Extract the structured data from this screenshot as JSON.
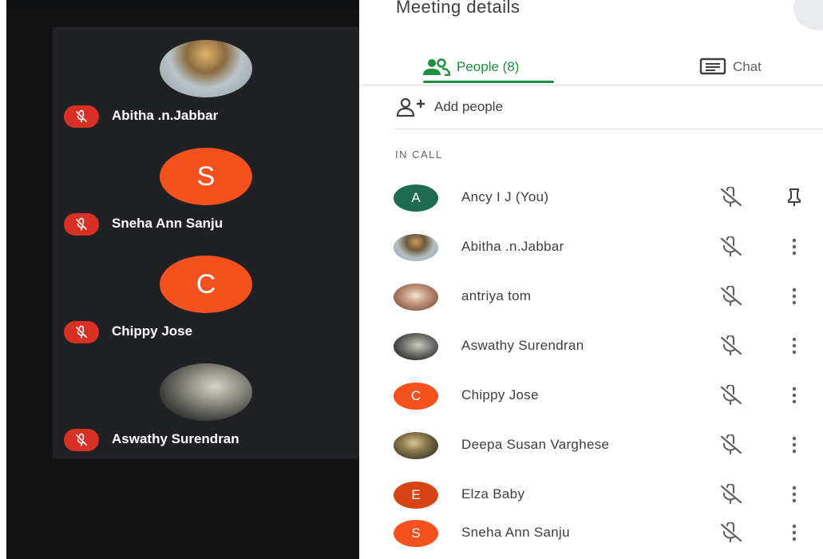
{
  "panel": {
    "title": "Meeting details",
    "tabs": [
      {
        "label": "People (8)",
        "icon": "people-icon",
        "active": true
      },
      {
        "label": "Chat",
        "icon": "chat-icon",
        "active": false
      }
    ],
    "add_people_label": "Add people",
    "section_label": "IN CALL",
    "participants": [
      {
        "name": "Ancy I J (You)",
        "avatar_letter": "A",
        "avatar_color": "#1e6b52",
        "action": "pin-icon"
      },
      {
        "name": "Abitha .n.Jabbar",
        "avatar_letter": "",
        "avatar_color": "#6f7f86",
        "action": "more-vert-icon"
      },
      {
        "name": "antriya tom",
        "avatar_letter": "",
        "avatar_color": "#b98d73",
        "action": "more-vert-icon"
      },
      {
        "name": "Aswathy Surendran",
        "avatar_letter": "",
        "avatar_color": "#5a5e5a",
        "action": "more-vert-icon"
      },
      {
        "name": "Chippy Jose",
        "avatar_letter": "C",
        "avatar_color": "#f4511e",
        "action": "more-vert-icon"
      },
      {
        "name": "Deepa Susan Varghese",
        "avatar_letter": "",
        "avatar_color": "#6b6a45",
        "action": "more-vert-icon"
      },
      {
        "name": "Elza Baby",
        "avatar_letter": "E",
        "avatar_color": "#d84315",
        "action": "more-vert-icon"
      },
      {
        "name": "Sneha Ann Sanju",
        "avatar_letter": "S",
        "avatar_color": "#f4511e",
        "action": "more-vert-icon"
      }
    ]
  },
  "video_tiles": [
    {
      "name": "Abitha .n.Jabbar",
      "avatar_letter": "",
      "avatar_color": "#7b8a8f"
    },
    {
      "name": "Sneha Ann Sanju",
      "avatar_letter": "S",
      "avatar_color": "#f4511e"
    },
    {
      "name": "Chippy Jose",
      "avatar_letter": "C",
      "avatar_color": "#f4511e"
    },
    {
      "name": "Aswathy Surendran",
      "avatar_letter": "",
      "avatar_color": "#5b605c"
    }
  ],
  "colors": {
    "accent": "#1e8e3e",
    "muted_badge": "#d93025",
    "tile_bg": "#202124"
  }
}
